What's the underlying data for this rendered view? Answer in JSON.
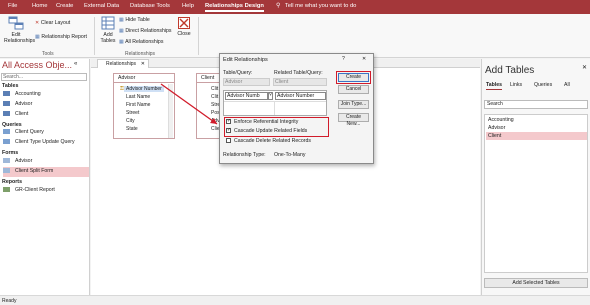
{
  "menu": {
    "file": "File",
    "home": "Home",
    "create": "Create",
    "external": "External Data",
    "dbtools": "Database Tools",
    "help": "Help",
    "reldesign": "Relationships Design",
    "tell": "Tell me what you want to do"
  },
  "ribbon": {
    "edit_rel_1": "Edit",
    "edit_rel_2": "Relationships",
    "clear_layout": "Clear Layout",
    "rel_report": "Relationship Report",
    "tools_group": "Tools",
    "add_tables_1": "Add",
    "add_tables_2": "Tables",
    "hide_table": "Hide Table",
    "direct_rel": "Direct Relationships",
    "all_rel": "All Relationships",
    "close": "Close",
    "rel_group": "Relationships"
  },
  "nav": {
    "title": "All Access Obje...",
    "search": "Search...",
    "tables_header": "Tables",
    "tables": [
      "Accounting",
      "Advisor",
      "Client"
    ],
    "queries_header": "Queries",
    "queries": [
      "Client Query",
      "Client Type Update Query"
    ],
    "forms_header": "Forms",
    "forms": [
      "Advisor",
      "Client Split Form"
    ],
    "reports_header": "Reports",
    "reports": [
      "GR-Client Report"
    ]
  },
  "doc": {
    "tab": "Relationships",
    "advisor": {
      "title": "Advisor",
      "fields": [
        "Advisor Number",
        "Last Name",
        "First Name",
        "Street",
        "City",
        "State"
      ]
    },
    "client": {
      "title": "Client",
      "fields": [
        "Clit",
        "Clit",
        "Stre",
        "Pos",
        "Adv",
        "Clie"
      ]
    }
  },
  "dialog": {
    "title": "Edit Relationships",
    "help": "?",
    "close": "✕",
    "table_label": "Table/Query:",
    "related_label": "Related Table/Query:",
    "table_value": "Advisor",
    "related_value": "Client",
    "field_left": "Advisor Numb",
    "field_right": "Advisor Number",
    "enforce": "Enforce Referential Integrity",
    "cascade_update": "Cascade Update Related Fields",
    "cascade_delete": "Cascade Delete Related Records",
    "rel_type_label": "Relationship Type:",
    "rel_type_value": "One-To-Many",
    "create": "Create",
    "cancel": "Cancel",
    "join_type": "Join Type...",
    "create_new": "Create New..."
  },
  "pane": {
    "title": "Add Tables",
    "tab_tables": "Tables",
    "tab_links": "Links",
    "tab_queries": "Queries",
    "tab_all": "All",
    "search": "Search",
    "items": [
      "Accounting",
      "Advisor",
      "Client"
    ],
    "add_button": "Add Selected Tables"
  },
  "status": "Ready",
  "colors": {
    "accent": "#a4373a",
    "highlight": "#d11b2a",
    "selected": "#f4c9cc"
  }
}
